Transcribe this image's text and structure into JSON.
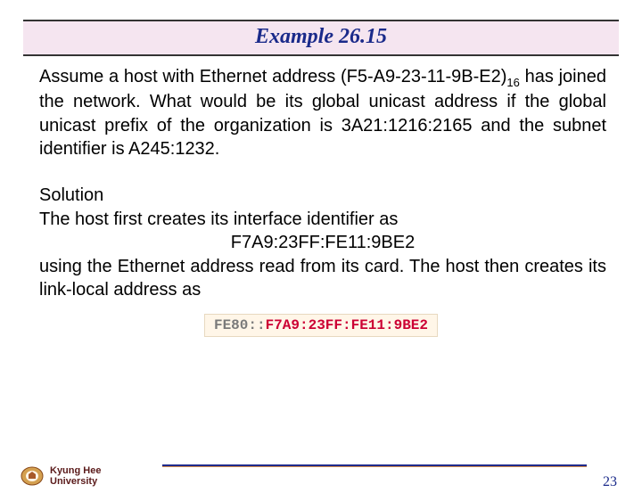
{
  "title": "Example 26.15",
  "question_part1": "Assume a host with Ethernet address (F5-A9-23-11-9B-E2)",
  "question_sub": "16",
  "question_part2": " has joined the network. What would be its global unicast address if the global unicast prefix of the organization is 3A21:1216:2165 and the subnet identifier is A245:1232.",
  "solution_label": "Solution",
  "solution_line1": "The host first creates its interface identifier as",
  "interface_id": "F7A9:23FF:FE11:9BE2",
  "solution_line2": "using the Ethernet address read from its card. The host then creates its link-local address as",
  "addr_prefix": "FE80::",
  "addr_suffix": "F7A9:23FF:FE11:9BE2",
  "university_line1": "Kyung Hee",
  "university_line2": "University",
  "page_number": "23"
}
